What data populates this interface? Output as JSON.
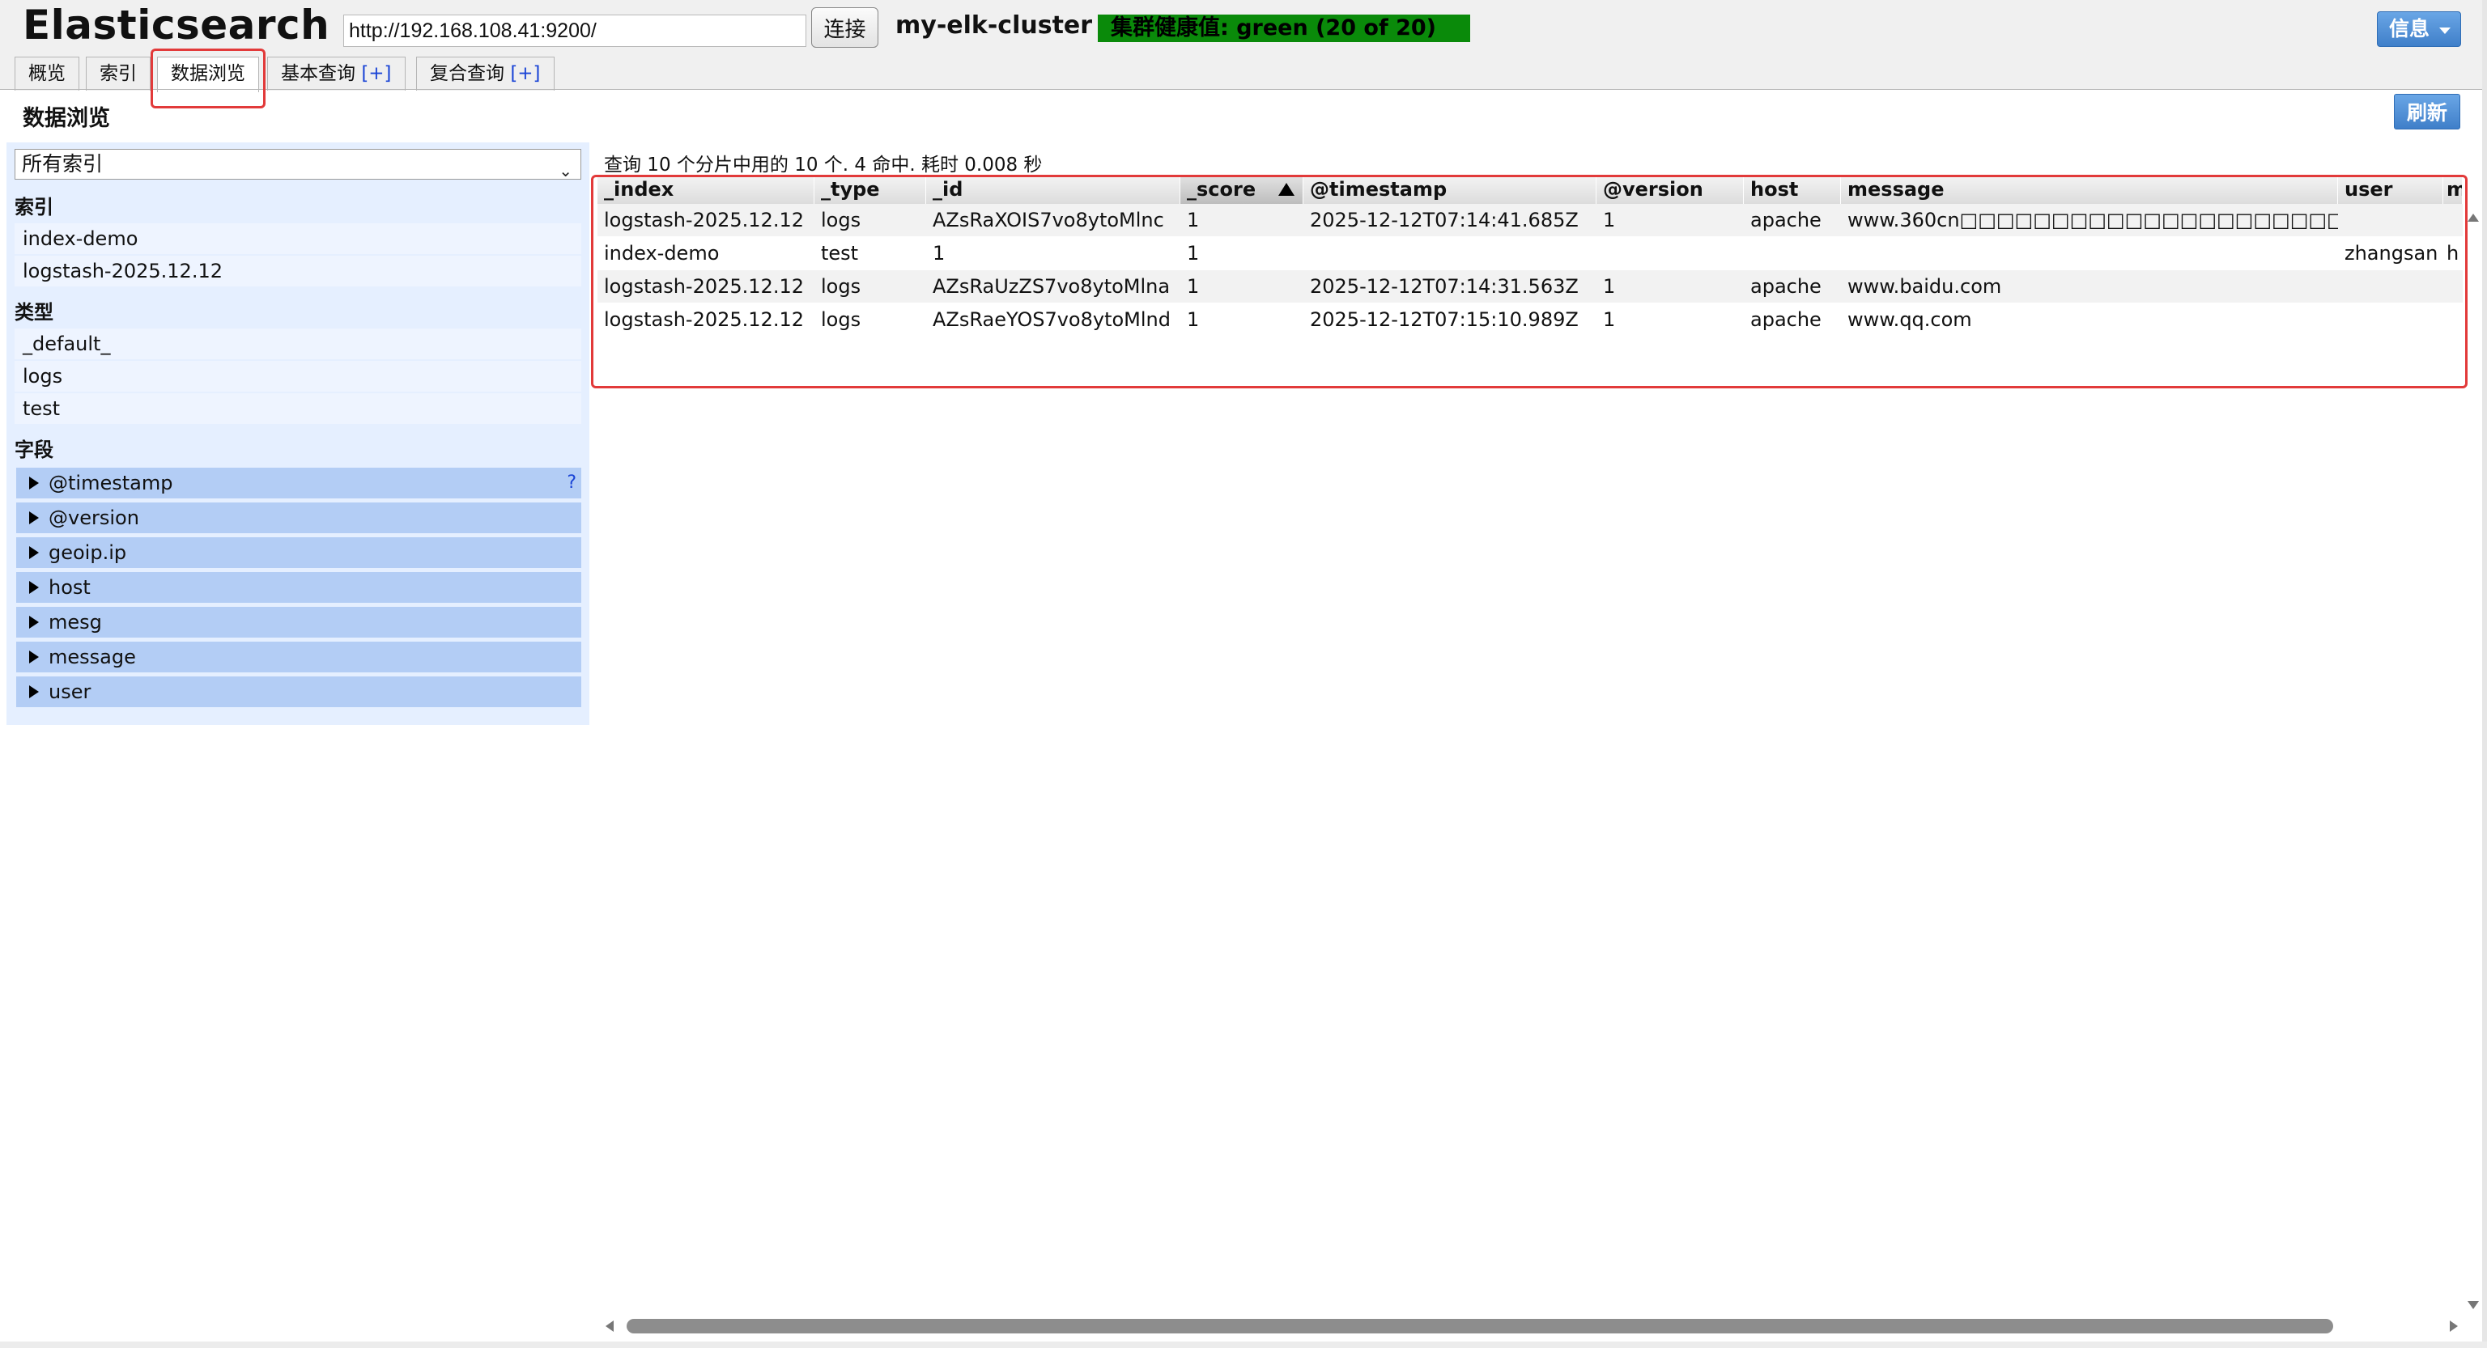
{
  "header": {
    "brand": "Elasticsearch",
    "url_value": "http://192.168.108.41:9200/",
    "connect_label": "连接",
    "cluster_name": "my-elk-cluster",
    "health": "集群健康值: green (20 of 20)",
    "health_color": "#0a8a0a",
    "info_label": "信息"
  },
  "tabs": [
    {
      "label": "概览"
    },
    {
      "label": "索引"
    },
    {
      "label": "数据浏览"
    },
    {
      "label": "基本查询",
      "plus": "[+]"
    },
    {
      "label": "复合查询",
      "plus": "[+]"
    }
  ],
  "page": {
    "title": "数据浏览",
    "refresh_label": "刷新"
  },
  "sidebar": {
    "select_value": "所有索引",
    "indices_heading": "索引",
    "indices": [
      "index-demo",
      "logstash-2025.12.12"
    ],
    "types_heading": "类型",
    "types": [
      "_default_",
      "logs",
      "test"
    ],
    "fields_heading": "字段",
    "fields": [
      "@timestamp",
      "@version",
      "geoip.ip",
      "host",
      "mesg",
      "message",
      "user"
    ],
    "help_mark": "?"
  },
  "results": {
    "summary": "查询 10 个分片中用的 10 个. 4 命中. 耗时 0.008 秒",
    "columns": [
      "_index",
      "_type",
      "_id",
      "_score",
      "@timestamp",
      "@version",
      "host",
      "message",
      "user",
      "mesg"
    ],
    "sorted_column": "_score",
    "rows": [
      [
        "logstash-2025.12.12",
        "logs",
        "AZsRaXOIS7vo8ytoMlnc",
        "1",
        "2025-12-12T07:14:41.685Z",
        "1",
        "apache",
        "www.360cn□□□□□□□□□□□□□□□□□□□□□",
        "",
        ""
      ],
      [
        "index-demo",
        "test",
        "1",
        "1",
        "",
        "",
        "",
        "",
        "zhangsan",
        "h"
      ],
      [
        "logstash-2025.12.12",
        "logs",
        "AZsRaUzZS7vo8ytoMlna",
        "1",
        "2025-12-12T07:14:31.563Z",
        "1",
        "apache",
        "www.baidu.com",
        "",
        ""
      ],
      [
        "logstash-2025.12.12",
        "logs",
        "AZsRaeYOS7vo8ytoMlnd",
        "1",
        "2025-12-12T07:15:10.989Z",
        "1",
        "apache",
        "www.qq.com",
        "",
        ""
      ]
    ]
  },
  "colors": {
    "accent_button": "#3f7fc9",
    "sidebar_bg": "#e5efff",
    "field_bg": "#b3cdf5",
    "highlight_box": "#e23a3a"
  }
}
